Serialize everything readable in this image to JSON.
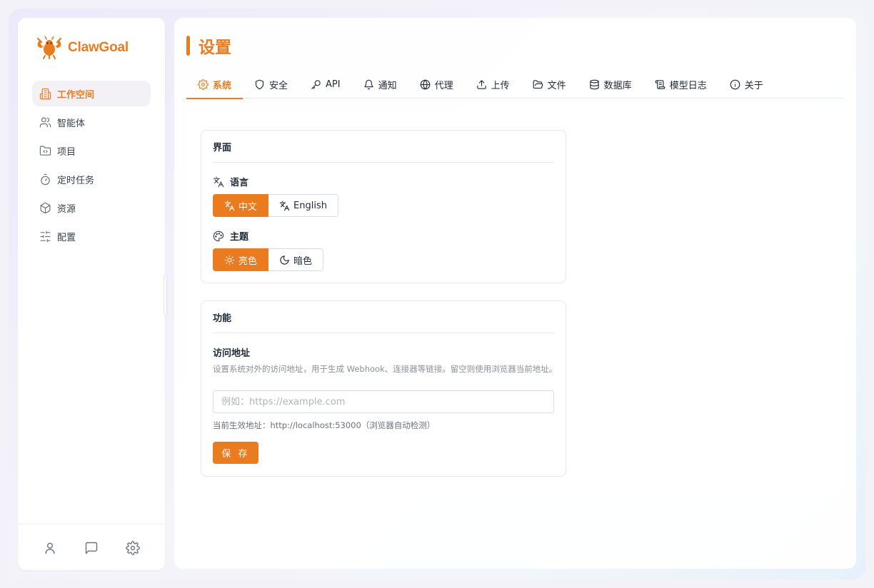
{
  "app": {
    "name": "ClawGoal"
  },
  "colors": {
    "accent": "#ea7b1f"
  },
  "sidebar": {
    "items": [
      {
        "label": "工作空间",
        "icon": "building-icon",
        "active": true
      },
      {
        "label": "智能体",
        "icon": "users-icon",
        "active": false
      },
      {
        "label": "项目",
        "icon": "folder-icon",
        "active": false
      },
      {
        "label": "定时任务",
        "icon": "timer-icon",
        "active": false
      },
      {
        "label": "资源",
        "icon": "box-icon",
        "active": false
      },
      {
        "label": "配置",
        "icon": "sliders-icon",
        "active": false
      }
    ],
    "footer": [
      "user-icon",
      "chat-icon",
      "settings-icon"
    ]
  },
  "page": {
    "title": "设置"
  },
  "tabs": [
    {
      "label": "系统",
      "icon": "gear-icon",
      "active": true
    },
    {
      "label": "安全",
      "icon": "shield-icon"
    },
    {
      "label": "API",
      "icon": "key-icon"
    },
    {
      "label": "通知",
      "icon": "bell-icon"
    },
    {
      "label": "代理",
      "icon": "globe-icon"
    },
    {
      "label": "上传",
      "icon": "upload-icon"
    },
    {
      "label": "文件",
      "icon": "folder-open-icon"
    },
    {
      "label": "数据库",
      "icon": "database-icon"
    },
    {
      "label": "模型日志",
      "icon": "scroll-icon"
    },
    {
      "label": "关于",
      "icon": "info-icon"
    }
  ],
  "interface_card": {
    "title": "界面",
    "language": {
      "label": "语言",
      "options": [
        "中文",
        "English"
      ],
      "selected": "中文"
    },
    "theme": {
      "label": "主题",
      "options": [
        "亮色",
        "暗色"
      ],
      "selected": "亮色"
    }
  },
  "feature_card": {
    "title": "功能",
    "access_url": {
      "label": "访问地址",
      "description": "设置系统对外的访问地址，用于生成 Webhook、连接器等链接。留空则使用浏览器当前地址。",
      "value": "",
      "placeholder": "例如：https://example.com",
      "current": "当前生效地址：http://localhost:53000（浏览器自动检测）"
    },
    "save_label": "保 存"
  }
}
